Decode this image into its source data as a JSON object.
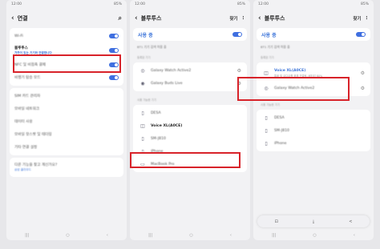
{
  "status_left": "12:00",
  "status_right": "85%",
  "screen1": {
    "back_glyph": "‹",
    "title": "연결",
    "search_glyph": "⌕",
    "rows": [
      {
        "label": "Wi-Fi",
        "has_toggle": true
      },
      {
        "label": "블루투스",
        "sub": "가까이 있는 기기와 연결합니다",
        "has_toggle": true
      },
      {
        "label": "NFC 및 비접촉 결제",
        "has_toggle": true
      },
      {
        "label": "비행기 탑승 모드",
        "has_toggle": true
      },
      {
        "label": "SIM 카드 관리자"
      },
      {
        "label": "모바일 네트워크"
      },
      {
        "label": "데이터 사용"
      },
      {
        "label": "모바일 핫스팟 및 테더링"
      },
      {
        "label": "기타 연결 설정"
      },
      {
        "label": "다른 기능을 찾고 계신가요?",
        "sub": "삼성 클라우드"
      }
    ]
  },
  "screen2": {
    "back_glyph": "‹",
    "title": "블루투스",
    "action": "찾기",
    "menu_glyph": "⋮",
    "on_label": "사용 중",
    "caption": "BT1 기기 검색 허용 중",
    "paired_label": "등록된 기기",
    "paired": [
      "Galaxy Watch Active2",
      "Galaxy Buds Live"
    ],
    "available_label": "사용 가능한 기기",
    "available": [
      "DESA",
      "Voice XL(A0CE)",
      "SM-J810",
      "iPhone",
      "MacBook Pro"
    ]
  },
  "screen3": {
    "back_glyph": "‹",
    "title": "블루투스",
    "action": "찾기",
    "menu_glyph": "⋮",
    "on_label": "사용 중",
    "caption": "BT1 기기 검색 허용 중",
    "paired_label": "등록된 기기",
    "selected_device": "Voice XL(A0CE)",
    "selected_desc": "통화 및 오디오를 위해 연결됨, 배터리 80%",
    "paired": [
      "Galaxy Watch Active2"
    ],
    "available_label": "사용 가능한 기기",
    "available": [
      "DESA",
      "SM-J810",
      "iPhone"
    ]
  },
  "navbar": [
    "|||",
    "○",
    "‹"
  ],
  "share_bar": [
    "⊡",
    "⤓",
    "<"
  ],
  "icons": {
    "device": "⚙",
    "selected": "◫",
    "watch": "◎",
    "buds": "◉",
    "laptop": "▭",
    "phone": "▯"
  }
}
